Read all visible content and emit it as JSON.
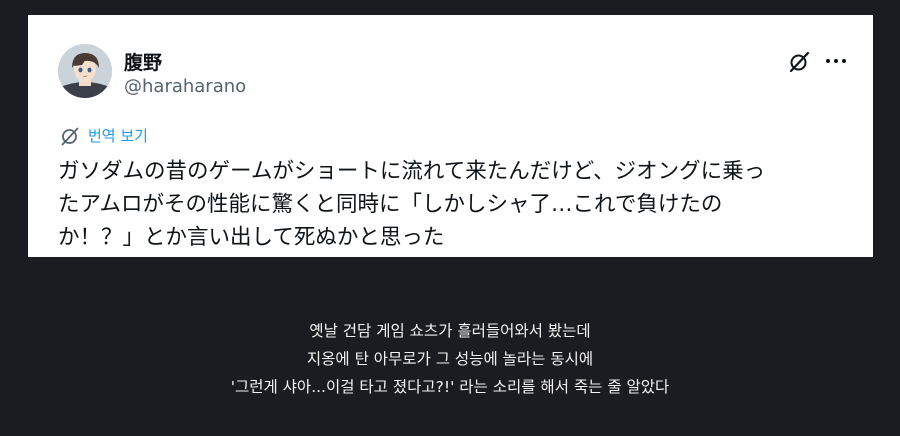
{
  "tweet": {
    "author_name": "腹野",
    "author_handle": "@haraharano",
    "translate_label": "번역 보기",
    "text": "ガソダムの昔のゲームがショートに流れて来たんだけど、ジオングに乗っ\nたアムロがその性能に驚くと同時に「しかしシャ了…これで負けたの\nか！？」とか言い出して死ぬかと思った",
    "icons": {
      "avatar": "avatar-portrait",
      "grok": "grok-icon",
      "more": "more-options-icon",
      "translate": "translate-globe-icon"
    },
    "colors": {
      "card_background": "#ffffff",
      "name": "#0f1419",
      "handle": "#536471",
      "translate": "#1d9bf0"
    }
  },
  "caption": {
    "text": "옛날 건담 게임 쇼츠가 흘러들어와서 봤는데\n지옹에 탄 아무로가 그 성능에 놀라는 동시에\n'그런게 샤아...이걸 타고 졌다고?!' 라는 소리를 해서 죽는 줄 알았다"
  },
  "page": {
    "background": "#1b1c22",
    "caption_color": "#f2f2f2"
  }
}
